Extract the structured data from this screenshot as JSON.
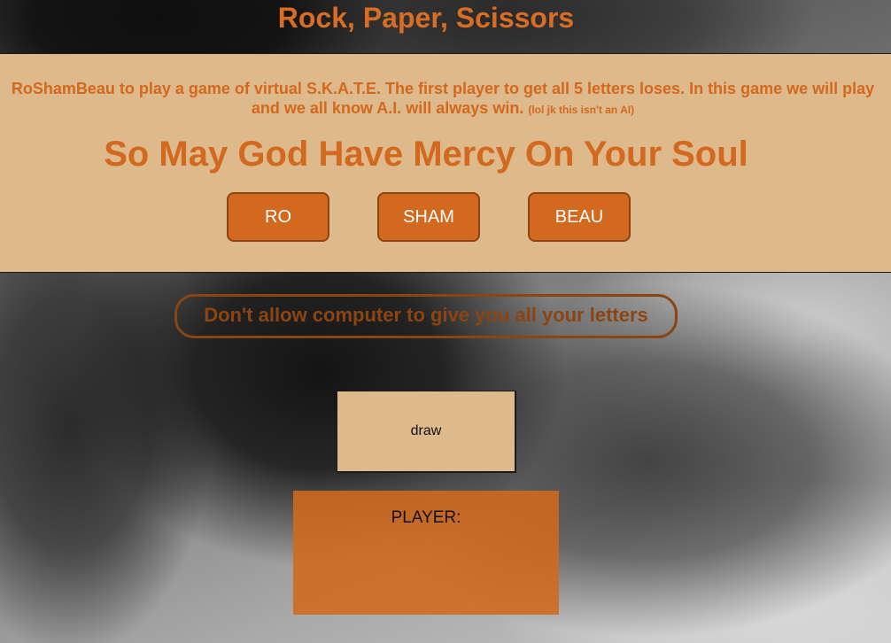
{
  "header": {
    "title": "Rock, Paper, Scissors"
  },
  "intro": {
    "line1": "RoShamBeau to play a game of virtual S.K.A.T.E. The first player to get all 5 letters loses. In this game we will play",
    "line2": "and we all know A.I. will always win.",
    "aside": "(lol jk this isn't an AI)",
    "tagline": "So May God Have Mercy On Your Soul"
  },
  "buttons": {
    "ro": "RO",
    "sham": "SHAM",
    "beau": "BEAU"
  },
  "warning": "Don't allow computer to give you all your letters",
  "result": {
    "text": "draw"
  },
  "player": {
    "label": "PLAYER:"
  },
  "colors": {
    "accent": "#d2691e",
    "panel": "#ddb98b",
    "border": "#8b4513"
  }
}
